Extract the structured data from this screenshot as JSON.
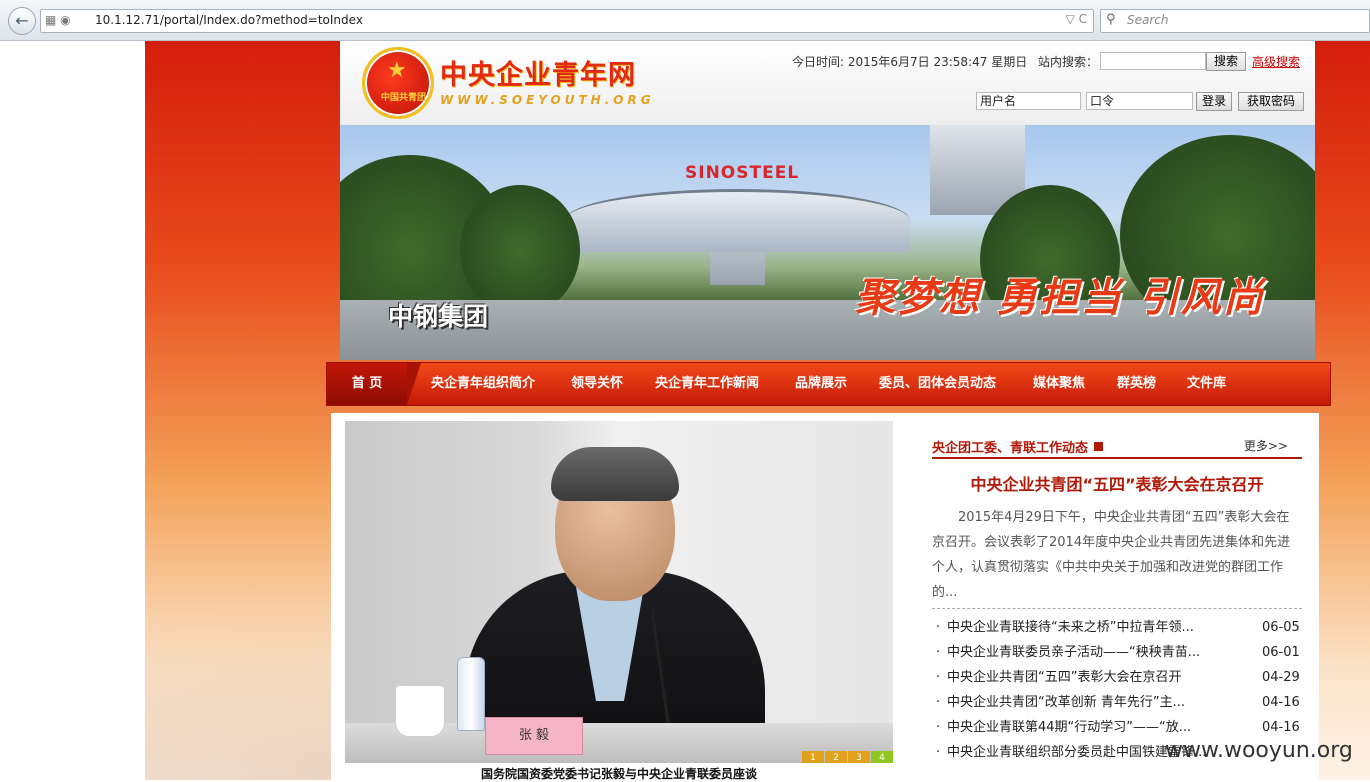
{
  "browser": {
    "back_icon": "back-arrow-icon",
    "url_icons": "▦ ◉",
    "url": "10.1.12.71/portal/Index.do?method=toIndex",
    "url_right_icons": "▽ C",
    "search_icon": "⚲",
    "search_placeholder": "Search"
  },
  "header": {
    "emblem_star": "★",
    "emblem_text": "中国共青团",
    "site_title": "中央企业青年网",
    "site_subtitle": "WWW.SOEYOUTH.ORG",
    "date_line": "今日时间: 2015年6月7日 23:58:47   星期日",
    "site_search_label": "站内搜索：",
    "search_button": "搜索",
    "advanced_search": "高级搜索",
    "username_field": "用户名",
    "password_field": "口令",
    "login_button": "登录",
    "get_password_button": "获取密码"
  },
  "banner": {
    "brand_sign": "SINOSTEEL",
    "company": "中钢集团",
    "slogan": "聚梦想 勇担当 引风尚"
  },
  "nav": {
    "home": "首 页",
    "items": [
      "央企青年组织简介",
      "领导关怀",
      "央企青年工作新闻",
      "品牌展示",
      "委员、团体会员动态",
      "媒体聚焦",
      "群英榜",
      "文件库"
    ]
  },
  "slideshow": {
    "nameplate": "张  毅",
    "dots": [
      "1",
      "2",
      "3",
      "4"
    ],
    "active_dot": 4,
    "caption": "国务院国资委党委书记张毅与中央企业青联委员座谈"
  },
  "news": {
    "section_title": "央企团工委、青联工作动态",
    "more": "更多>>",
    "headline": "中央企业共青团“五四”表彰大会在京召开",
    "summary": "2015年4月29日下午，中央企业共青团“五四”表彰大会在京召开。会议表彰了2014年度中央企业共青团先进集体和先进个人，认真贯彻落实《中共中央关于加强和改进党的群团工作的...",
    "items": [
      {
        "title": "中央企业青联接待“未来之桥”中拉青年领...",
        "date": "06-05"
      },
      {
        "title": "中央企业青联委员亲子活动——“秧秧青苗...",
        "date": "06-01"
      },
      {
        "title": "中央企业共青团“五四”表彰大会在京召开",
        "date": "04-29"
      },
      {
        "title": "中央企业共青团“改革创新 青年先行”主...",
        "date": "04-16"
      },
      {
        "title": "中央企业青联第44期“行动学习”——“放...",
        "date": "04-16"
      },
      {
        "title": "中央企业青联组织部分委员赴中国铁建雷锋...",
        "date": ""
      }
    ]
  },
  "watermark": "www.wooyun.org",
  "colors": {
    "primary_red": "#d41e0b",
    "nav_red": "#c41908",
    "accent_gold": "#f2c21b"
  }
}
